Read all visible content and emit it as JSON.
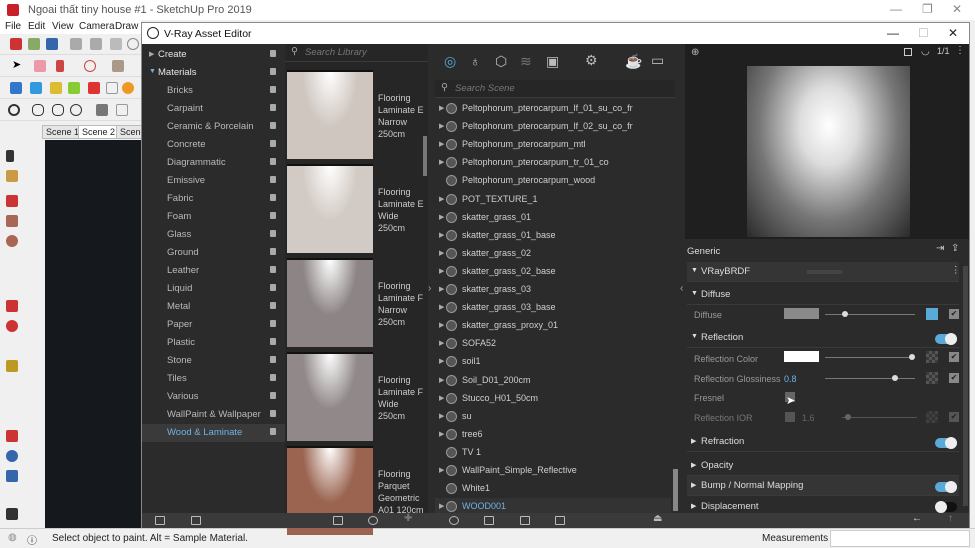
{
  "sketchup": {
    "title": "Ngoai thất tiny house #1 - SketchUp Pro 2019",
    "menu": [
      "File",
      "Edit",
      "View",
      "Camera",
      "Draw"
    ],
    "scenes": [
      "Scene 1",
      "Scene 2",
      "Scene"
    ],
    "status": "Select object to paint. Alt = Sample Material.",
    "measurements_label": "Measurements"
  },
  "vray": {
    "title": "V-Ray Asset Editor",
    "categories": {
      "create": "Create",
      "materials": "Materials",
      "items": [
        "Bricks",
        "Carpaint",
        "Ceramic & Porcelain",
        "Concrete",
        "Diagrammatic",
        "Emissive",
        "Fabric",
        "Foam",
        "Glass",
        "Ground",
        "Leather",
        "Liquid",
        "Metal",
        "Paper",
        "Plastic",
        "Stone",
        "Tiles",
        "Various",
        "WallPaint & Wallpaper",
        "Wood & Laminate"
      ],
      "selected": "Wood & Laminate"
    },
    "library": {
      "search_placeholder": "Search Library",
      "items": [
        {
          "label": "Flooring Laminate E Narrow 250cm",
          "color": "#cfc6c0"
        },
        {
          "label": "Flooring Laminate E Wide 250cm",
          "color": "#d2cac4"
        },
        {
          "label": "Flooring Laminate F Narrow 250cm",
          "color": "#8d8585"
        },
        {
          "label": "Flooring Laminate F Wide 250cm",
          "color": "#918989"
        },
        {
          "label": "Flooring Parquet Geometric A01 120cm",
          "color": "#9a6450"
        }
      ]
    },
    "scene": {
      "search_placeholder": "Search Scene",
      "items": [
        {
          "name": "Peltophorum_pterocarpum_lf_01_su_co_fr",
          "expand": true
        },
        {
          "name": "Peltophorum_pterocarpum_lf_02_su_co_fr",
          "expand": true
        },
        {
          "name": "Peltophorum_pterocarpum_mtl",
          "expand": true
        },
        {
          "name": "Peltophorum_pterocarpum_tr_01_co",
          "expand": true
        },
        {
          "name": "Peltophorum_pterocarpum_wood",
          "expand": false
        },
        {
          "name": "POT_TEXTURE_1",
          "expand": true
        },
        {
          "name": "skatter_grass_01",
          "expand": true
        },
        {
          "name": "skatter_grass_01_base",
          "expand": true
        },
        {
          "name": "skatter_grass_02",
          "expand": true
        },
        {
          "name": "skatter_grass_02_base",
          "expand": true
        },
        {
          "name": "skatter_grass_03",
          "expand": true
        },
        {
          "name": "skatter_grass_03_base",
          "expand": true
        },
        {
          "name": "skatter_grass_proxy_01",
          "expand": true
        },
        {
          "name": "SOFA52",
          "expand": true
        },
        {
          "name": "soil1",
          "expand": true
        },
        {
          "name": "Soil_D01_200cm",
          "expand": true
        },
        {
          "name": "Stucco_H01_50cm",
          "expand": true
        },
        {
          "name": "su",
          "expand": true
        },
        {
          "name": "tree6",
          "expand": true
        },
        {
          "name": "TV 1",
          "expand": false
        },
        {
          "name": "WallPaint_Simple_Reflective",
          "expand": true
        },
        {
          "name": "White1",
          "expand": false
        },
        {
          "name": "WOOD001",
          "expand": true
        }
      ],
      "selected": "WOOD001"
    },
    "props": {
      "header": "Generic",
      "brdf": "VRayBRDF",
      "diffuse_section": "Diffuse",
      "diffuse_label": "Diffuse",
      "diffuse_color": "#8a8a8a",
      "diffuse_amount": 0.2,
      "reflection_section": "Reflection",
      "reflection_on": true,
      "reflection_color_label": "Reflection Color",
      "reflection_color": "#ffffff",
      "reflection_amount": 1.0,
      "gloss_label": "Reflection Glossiness",
      "gloss_value": "0.8",
      "gloss_amount": 0.8,
      "fresnel_label": "Fresnel",
      "fresnel_checked": false,
      "ior_label": "Reflection IOR",
      "ior_value": "1.6",
      "refraction": "Refraction",
      "refraction_on": true,
      "opacity": "Opacity",
      "bump": "Bump / Normal Mapping",
      "bump_on": true,
      "displacement": "Displacement",
      "displacement_on": false,
      "resolution_label": "1/1"
    },
    "accent": "#5aa9d8"
  }
}
